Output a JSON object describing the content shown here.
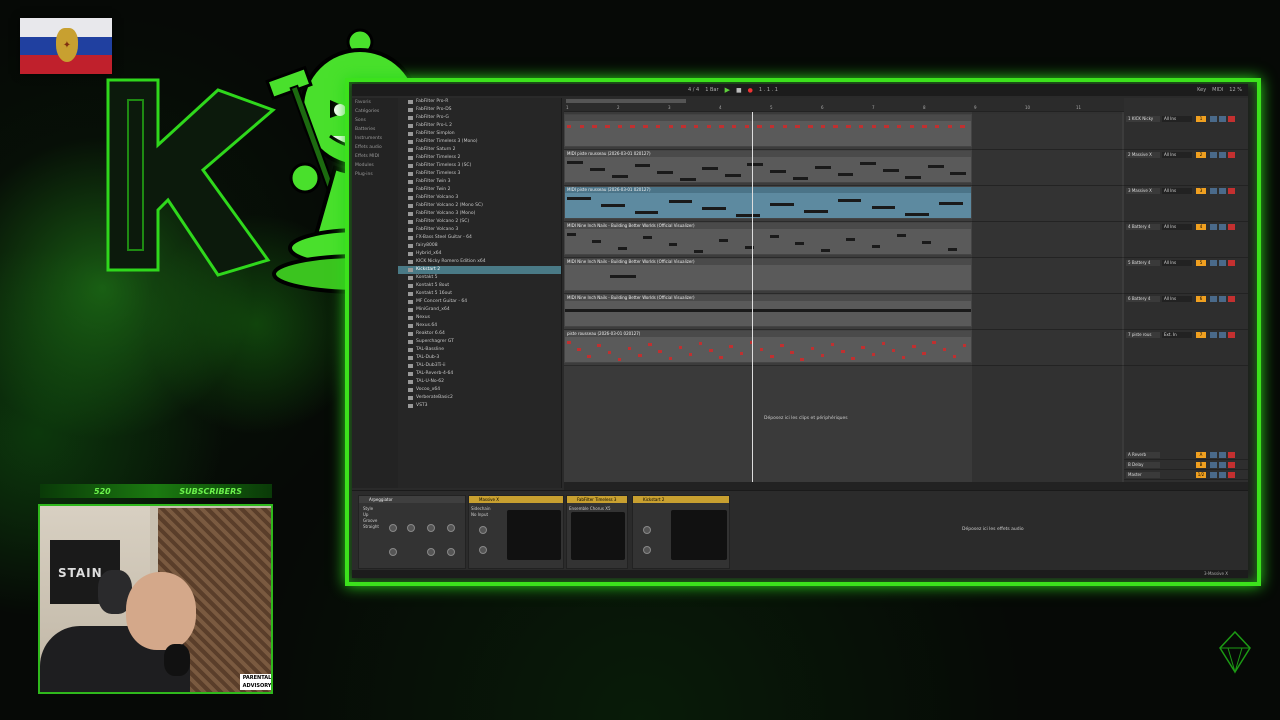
{
  "stream": {
    "subscriber_count": "520",
    "subscriber_label": "SUBSCRIBERS"
  },
  "toolbar": {
    "tempo_sig": "4 / 4",
    "bar_label": "1 Bar",
    "position": "1 . 1 . 1",
    "key_label": "Key",
    "midi_label": "MIDI",
    "cpu": "12 %"
  },
  "browser": {
    "places": [
      "Favoris",
      "Catégories",
      "Sons",
      "Batteries",
      "Instruments",
      "Effets audio",
      "Effets MIDI",
      "Modules",
      "Plug-ins"
    ],
    "items": [
      "FabFilter Pro-R",
      "FabFilter Pro-DS",
      "FabFilter Pro-G",
      "FabFilter Pro-L 2",
      "FabFilter Simplon",
      "FabFilter Timeless 3 (Mono)",
      "FabFilter Saturn 2",
      "FabFilter Timeless 2",
      "FabFilter Timeless 3 (SC)",
      "FabFilter Timeless 3",
      "FabFilter Twin 3",
      "FabFilter Twin 2",
      "FabFilter Volcano 3",
      "FabFilter Volcano 2 (Mono SC)",
      "FabFilter Volcano 3 (Mono)",
      "FabFilter Volcano 2 (SC)",
      "FabFilter Volcano 3",
      "FX-Bass Steel Guitar - 64",
      "fairy8008",
      "Hybrid_x64",
      "KICK Nicky Romero Edition x64",
      "Kickstart 2",
      "Kontakt 5",
      "Kontakt 5 8out",
      "Kontakt 5 16out",
      "MF Concert Guitar - 64",
      "MiniGrand_x64",
      "Nexus",
      "Nexus.64",
      "Reaktor 6.64",
      "Superchagrer GT",
      "TAL-Bassline",
      "TAL-Dub-3",
      "TAL-Dub3Ti-ii",
      "TAL-Reverb-4-64",
      "TAL-U-No-62",
      "Vocoo_x64",
      "VerberateBasic2",
      "VST3"
    ],
    "selected_index": 21
  },
  "tracks": [
    {
      "clip": "",
      "name": "1 KICK Nicky",
      "io": "All Ins",
      "num": "1"
    },
    {
      "clip": "MIDI piste rousseau (2026-03-01 020127)",
      "name": "2 Massive X",
      "io": "All Ins",
      "num": "2"
    },
    {
      "clip": "MIDI piste rousseau (2026-03-01 020127)",
      "name": "3 Massive X",
      "io": "All Ins",
      "num": "3"
    },
    {
      "clip": "MIDI Nine Inch Nails - Building Better Worlds (Official Visualizer)",
      "name": "4 Battery 4",
      "io": "All Ins",
      "num": "4"
    },
    {
      "clip": "MIDI Nine Inch Nails - Building Better Worlds (Official Visualizer)",
      "name": "5 Battery 4",
      "io": "All Ins",
      "num": "5"
    },
    {
      "clip": "MIDI Nine Inch Nails - Building Better Worlds (Official Visualizer)",
      "name": "6 Battery 4",
      "io": "All Ins",
      "num": "6"
    },
    {
      "clip": "piste rousseau (2026-03-01 020127)",
      "name": "7 piste rous",
      "io": "Ext. In",
      "num": "7"
    }
  ],
  "returns": [
    {
      "name": "A Reverb",
      "num": "A"
    },
    {
      "name": "B Delay",
      "num": "B"
    },
    {
      "name": "Master",
      "num": "1/2"
    }
  ],
  "arrangement": {
    "drop_hint": "Déposez ici les clips et périphériques",
    "bar_numbers": [
      "1",
      "2",
      "3",
      "4",
      "5",
      "6",
      "7",
      "8",
      "9",
      "10",
      "11"
    ]
  },
  "devices": {
    "items": [
      "Arpeggiator",
      "Massive X",
      "FabFilter Timeless 3",
      "Kickstart 2"
    ],
    "arp_params": [
      "Style",
      "Up",
      "Groove",
      "Straight",
      "Offset",
      "Transpose",
      "Shift",
      "Key",
      "Velocity",
      "Off",
      "Rate",
      "Gate",
      "Steps",
      "Decay",
      "Retrigger",
      "Repeats",
      "Distance",
      "Target"
    ],
    "plugin_labels": [
      "Ensemble Chorus X5",
      "Sidechain",
      "No Input",
      "Gain",
      "Mix"
    ],
    "drop_hint": "Déposez ici les effets audio",
    "status_right": "3-Massive X"
  }
}
